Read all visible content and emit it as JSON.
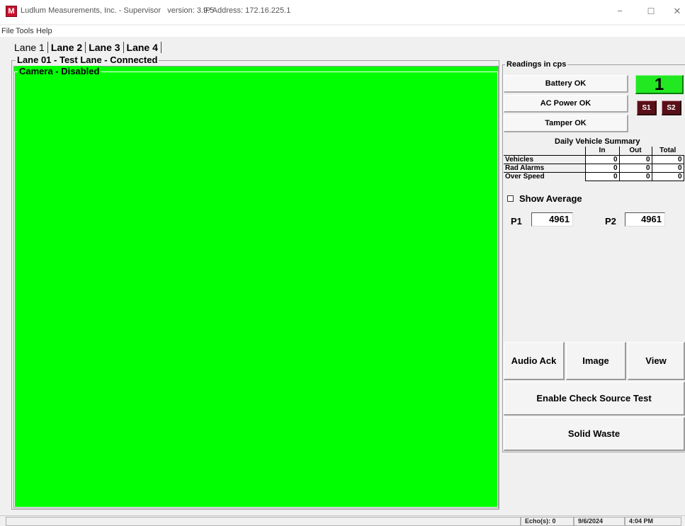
{
  "window": {
    "title": "Ludlum Measurements, Inc. - Supervisor   version: 3.9.5",
    "ip_address": "IP Address:  172.16.225.1",
    "app_icon_glyph": "M",
    "min_glyph": "−",
    "max_glyph": "☐",
    "close_glyph": "✕"
  },
  "menu": [
    "File",
    "Tools",
    "Help"
  ],
  "lanes": {
    "tabs": [
      "Lane 1",
      "Lane 2",
      "Lane 3",
      "Lane 4"
    ],
    "active": "Lane 1"
  },
  "lane_group_title": "Lane 01 - Test Lane - Connected",
  "camera_title": "Camera - Disabled",
  "readings": {
    "title": "Readings in cps",
    "battery": "Battery OK",
    "ac_power": "AC Power OK",
    "tamper": "Tamper OK",
    "count": "1",
    "s1": "S1",
    "s2": "S2"
  },
  "summary": {
    "title": "Daily Vehicle Summary",
    "headers": [
      "In",
      "Out",
      "Total"
    ],
    "rows": [
      {
        "label": "Vehicles",
        "in": "0",
        "out": "0",
        "total": "0"
      },
      {
        "label": "Rad Alarms",
        "in": "0",
        "out": "0",
        "total": "0"
      },
      {
        "label": "Over Speed",
        "in": "0",
        "out": "0",
        "total": "0"
      }
    ]
  },
  "show_average": {
    "label": "Show Average",
    "checked": false
  },
  "p1": {
    "label": "P1",
    "value": "4961"
  },
  "p2": {
    "label": "P2",
    "value": "4961"
  },
  "buttons": {
    "audio_ack": "Audio Ack",
    "image": "Image",
    "view": "View",
    "check_source": "Enable Check Source Test",
    "solid_waste": "Solid Waste"
  },
  "statusbar": {
    "echo": "Echo(s): 0",
    "date": "9/6/2024",
    "time": "4:04 PM"
  },
  "colors": {
    "camera_bg": "#00ff00",
    "count_bg": "#22e822",
    "source_btn_bg": "#5a1018",
    "app_icon": "#c8102e"
  }
}
